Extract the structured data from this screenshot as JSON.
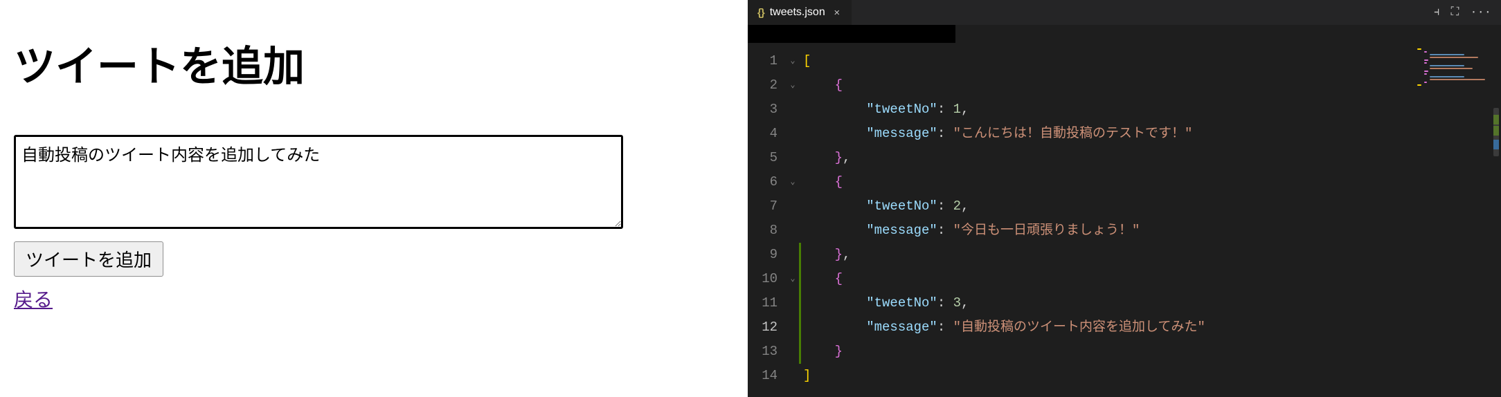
{
  "left": {
    "title": "ツイートを追加",
    "textarea_value": "自動投稿のツイート内容を追加してみた",
    "submit_label": "ツイートを追加",
    "back_label": "戻る"
  },
  "editor": {
    "tab": {
      "icon_text": "{}",
      "filename": "tweets.json",
      "close_glyph": "×"
    },
    "actions": {
      "split_glyph": "⫞",
      "lock_glyph": "⛶",
      "more_glyph": "···"
    },
    "line_numbers": [
      "1",
      "2",
      "3",
      "4",
      "5",
      "6",
      "7",
      "8",
      "9",
      "10",
      "11",
      "12",
      "13",
      "14"
    ],
    "active_line_index": 11,
    "fold_markers": {
      "0": "v",
      "1": "v",
      "5": "v",
      "9": "v"
    },
    "code": {
      "open_bracket": "[",
      "close_bracket": "]",
      "obj_open": "{",
      "obj_close_comma": "},",
      "obj_close": "}",
      "colon": ": ",
      "comma": ",",
      "key_tweetNo": "\"tweetNo\"",
      "key_message": "\"message\"",
      "entries": [
        {
          "tweetNo": "1",
          "message": "\"こんにちは！自動投稿のテストです！\""
        },
        {
          "tweetNo": "2",
          "message": "\"今日も一日頑張りましょう！\""
        },
        {
          "tweetNo": "3",
          "message": "\"自動投稿のツイート内容を追加してみた\""
        }
      ]
    }
  }
}
